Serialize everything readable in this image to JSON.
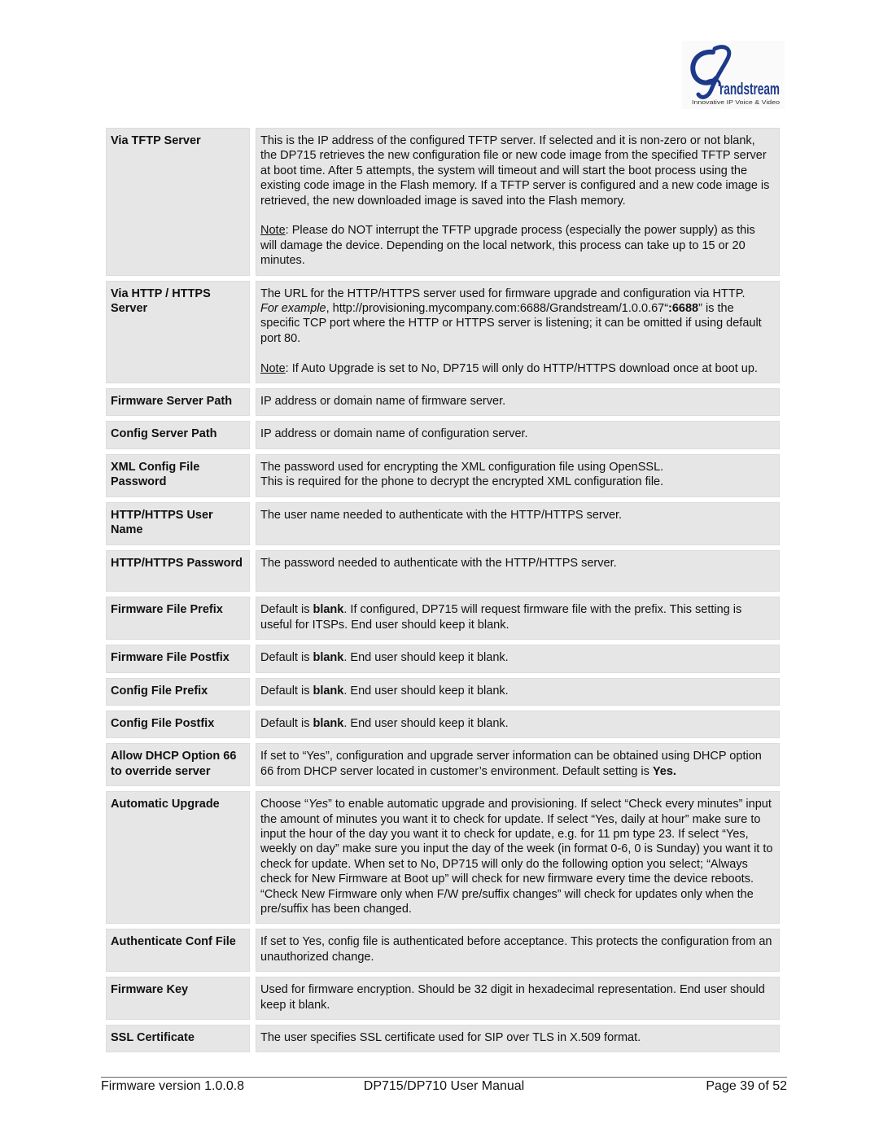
{
  "header": {
    "logo": {
      "brand": "Grandstream",
      "brand_initial": "G",
      "brand_rest": "randstream",
      "tagline": "Innovative IP Voice & Video",
      "color": "#1d3a8a"
    }
  },
  "rows": [
    {
      "label": "Via TFTP Server",
      "paragraphs": [
        [
          {
            "t": "This is the IP address of the configured TFTP server.  If selected and it is non-zero or not blank, the DP715 retrieves the new configuration file or new code image from the specified TFTP server at boot time.  After 5 attempts, the system will timeout and will start the boot process using the existing code image in the Flash memory.  If a TFTP server is configured and a new code image is retrieved, the new downloaded image is saved into the Flash memory."
          }
        ],
        [
          {
            "t": "Note",
            "s": "u"
          },
          {
            "t": ": Please do NOT interrupt the TFTP upgrade process (especially the power supply) as this will damage the device.  Depending on the local network, this process can take up to 15 or 20 minutes."
          }
        ]
      ]
    },
    {
      "label": "Via HTTP / HTTPS Server",
      "paragraphs": [
        [
          {
            "t": "The URL for the HTTP/HTTPS server used for firmware upgrade and configuration via HTTP."
          },
          {
            "t": "\n"
          },
          {
            "t": "For example",
            "s": "i"
          },
          {
            "t": ", http://provisioning.mycompany.com:6688/Grandstream/1.0.0.67“"
          },
          {
            "t": ":6688",
            "s": "b"
          },
          {
            "t": "” is the specific TCP port where the HTTP or HTTPS server is listening; it can be omitted if using default port 80."
          }
        ],
        [
          {
            "t": "Note",
            "s": "u"
          },
          {
            "t": ": If Auto Upgrade is set to No, DP715 will only do HTTP/HTTPS download once at boot up."
          }
        ]
      ]
    },
    {
      "label": "Firmware Server Path",
      "paragraphs": [
        [
          {
            "t": "IP address or domain name of firmware server."
          }
        ]
      ]
    },
    {
      "label": "Config Server Path",
      "paragraphs": [
        [
          {
            "t": "IP address or domain name of configuration server."
          }
        ]
      ]
    },
    {
      "label": "XML Config File Password",
      "paragraphs": [
        [
          {
            "t": "The password used for encrypting the XML configuration file using OpenSSL."
          },
          {
            "t": "\n"
          },
          {
            "t": "This is required for the phone to decrypt the encrypted XML configuration file."
          }
        ]
      ]
    },
    {
      "label": "HTTP/HTTPS User Name",
      "min_lines": 2,
      "paragraphs": [
        [
          {
            "t": "The user name needed to authenticate with the HTTP/HTTPS server."
          }
        ]
      ]
    },
    {
      "label": "HTTP/HTTPS Password",
      "min_lines": 2,
      "paragraphs": [
        [
          {
            "t": "The password needed to authenticate with the HTTP/HTTPS server."
          }
        ]
      ]
    },
    {
      "label": "Firmware File Prefix",
      "paragraphs": [
        [
          {
            "t": "Default is "
          },
          {
            "t": "blank",
            "s": "b"
          },
          {
            "t": ". If configured, DP715 will request firmware file with the prefix.  This setting is useful for ITSPs.  End user should keep it blank."
          }
        ]
      ]
    },
    {
      "label": "Firmware File Postfix",
      "paragraphs": [
        [
          {
            "t": "Default is "
          },
          {
            "t": "blank",
            "s": "b"
          },
          {
            "t": ".  End user should keep it blank."
          }
        ]
      ]
    },
    {
      "label": "Config File Prefix",
      "paragraphs": [
        [
          {
            "t": "Default is "
          },
          {
            "t": "blank",
            "s": "b"
          },
          {
            "t": ".  End user should keep it blank."
          }
        ]
      ]
    },
    {
      "label": "Config File Postfix",
      "paragraphs": [
        [
          {
            "t": "Default is "
          },
          {
            "t": "blank",
            "s": "b"
          },
          {
            "t": ".  End user should keep it blank."
          }
        ]
      ]
    },
    {
      "label": "Allow DHCP Option 66 to override server",
      "paragraphs": [
        [
          {
            "t": "If set to “Yes”, configuration and upgrade server information can be obtained using DHCP option 66 from DHCP server located in customer’s environment. Default setting is "
          },
          {
            "t": "Yes.",
            "s": "b"
          }
        ]
      ]
    },
    {
      "label": "Automatic Upgrade",
      "paragraphs": [
        [
          {
            "t": "Choose “"
          },
          {
            "t": "Yes",
            "s": "i"
          },
          {
            "t": "” to enable automatic upgrade and provisioning.  If select “Check every minutes” input the amount of minutes you want it to check for update. If select “Yes, daily at hour” make sure to input the hour of the day you want it to check for update, e.g. for 11 pm type 23. If select “Yes, weekly on day” make sure you input the day of the week (in format 0-6, 0 is Sunday) you want it to check for update.  When set to No, DP715 will only do the following option you select; “Always check for New Firmware at Boot up” will check for new firmware every time the device reboots. “Check New Firmware only when F/W pre/suffix changes” will check for updates only when the pre/suffix has been changed."
          }
        ]
      ]
    },
    {
      "label": "Authenticate Conf File",
      "paragraphs": [
        [
          {
            "t": "If set to Yes, config file is authenticated before acceptance.  This protects the configuration from an unauthorized change."
          }
        ]
      ]
    },
    {
      "label": "Firmware Key",
      "paragraphs": [
        [
          {
            "t": "Used for firmware encryption.  Should be 32 digit in hexadecimal representation.  End user should keep it blank."
          }
        ]
      ]
    },
    {
      "label": "SSL Certificate",
      "paragraphs": [
        [
          {
            "t": "The user specifies SSL certificate used for SIP over TLS in X.509 format."
          }
        ]
      ]
    }
  ],
  "footer": {
    "firmware": "Firmware version 1.0.0.8",
    "title": "DP715/DP710 User Manual",
    "page": "Page 39 of 52"
  }
}
